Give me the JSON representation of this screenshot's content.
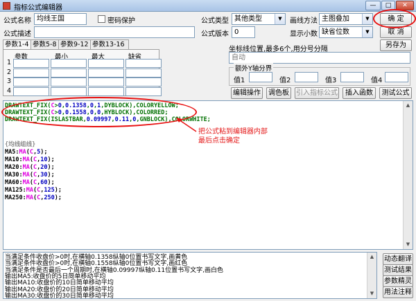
{
  "window": {
    "title": "指标公式编辑器",
    "btn_min": "—",
    "btn_max": "□",
    "btn_close": "✕"
  },
  "form": {
    "name_label": "公式名称",
    "name_value": "均线王国",
    "password_label": "密码保护",
    "desc_label": "公式描述",
    "desc_value": "",
    "type_label": "公式类型",
    "type_value": "其他类型",
    "draw_label": "画线方法",
    "draw_value": "主图叠加",
    "version_label": "公式版本",
    "version_value": "0",
    "decimal_label": "显示小数",
    "decimal_value": "缺省位数",
    "coord_label": "坐标线位置,最多6个,用分号分隔",
    "coord_value": "自动",
    "extra_y_label": "额外Y轴分界",
    "y_labels": [
      "值1",
      "值2",
      "值3",
      "值4"
    ]
  },
  "buttons": {
    "confirm": "确 定",
    "cancel": "取 消",
    "save_as": "另存为",
    "edit_op": "编辑操作",
    "palette": "调色板",
    "import_formula": "引入指标公式",
    "insert_func": "插入函数",
    "test_formula": "测试公式",
    "dynamic_translate": "动态翻译",
    "test_result": "测试结果",
    "param_wizard": "参数精灵",
    "usage_notes": "用法注释"
  },
  "tabs": [
    "参数1-4",
    "参数5-8",
    "参数9-12",
    "参数13-16"
  ],
  "params": {
    "headers": [
      "参数",
      "最小",
      "最大",
      "缺省"
    ],
    "rows": [
      "1",
      "2",
      "3",
      "4"
    ]
  },
  "code": [
    {
      "segs": [
        {
          "t": "DRAWTEXT_FIX(",
          "c": "#007000"
        },
        {
          "t": "C",
          "c": "#e000e0"
        },
        {
          "t": ">",
          "c": "#007000"
        },
        {
          "t": "0",
          "c": "#0000c0"
        },
        {
          "t": ",",
          "c": "#007000"
        },
        {
          "t": "0.1358",
          "c": "#0000c0"
        },
        {
          "t": ",",
          "c": "#007000"
        },
        {
          "t": "0",
          "c": "#0000c0"
        },
        {
          "t": ",",
          "c": "#007000"
        },
        {
          "t": "1",
          "c": "#0000c0"
        },
        {
          "t": ",DYBLOCK),COLORYELLOW;",
          "c": "#007000"
        }
      ]
    },
    {
      "segs": [
        {
          "t": "DRAWTEXT_FIX(",
          "c": "#007000"
        },
        {
          "t": "C",
          "c": "#e000e0"
        },
        {
          "t": ">",
          "c": "#007000"
        },
        {
          "t": "0",
          "c": "#0000c0"
        },
        {
          "t": ",",
          "c": "#007000"
        },
        {
          "t": "0.1558",
          "c": "#0000c0"
        },
        {
          "t": ",",
          "c": "#007000"
        },
        {
          "t": "0",
          "c": "#0000c0"
        },
        {
          "t": ",",
          "c": "#007000"
        },
        {
          "t": "0",
          "c": "#0000c0"
        },
        {
          "t": ",HYBLOCK),COLORRED;",
          "c": "#007000"
        }
      ]
    },
    {
      "segs": [
        {
          "t": "DRAWTEXT_FIX(ISLASTBAR,",
          "c": "#007000"
        },
        {
          "t": "0.09997",
          "c": "#0000c0"
        },
        {
          "t": ",",
          "c": "#007000"
        },
        {
          "t": "0.11",
          "c": "#0000c0"
        },
        {
          "t": ",",
          "c": "#007000"
        },
        {
          "t": "0",
          "c": "#0000c0"
        },
        {
          "t": ",GNBLOCK),COLORWHITE;",
          "c": "#007000"
        }
      ]
    },
    {
      "segs": [
        {
          "t": "",
          "c": "#000"
        }
      ]
    },
    {
      "segs": [
        {
          "t": "{均线组线}",
          "c": "#8a8a8a"
        }
      ]
    },
    {
      "segs": [
        {
          "t": "MA5:",
          "c": "#000"
        },
        {
          "t": "MA",
          "c": "#e000e0"
        },
        {
          "t": "(",
          "c": "#000"
        },
        {
          "t": "C",
          "c": "#e000e0"
        },
        {
          "t": ",",
          "c": "#000"
        },
        {
          "t": "5",
          "c": "#0000c0"
        },
        {
          "t": ");",
          "c": "#000"
        }
      ]
    },
    {
      "segs": [
        {
          "t": "MA10:",
          "c": "#000"
        },
        {
          "t": "MA",
          "c": "#e000e0"
        },
        {
          "t": "(",
          "c": "#000"
        },
        {
          "t": "C",
          "c": "#e000e0"
        },
        {
          "t": ",",
          "c": "#000"
        },
        {
          "t": "10",
          "c": "#0000c0"
        },
        {
          "t": ");",
          "c": "#000"
        }
      ]
    },
    {
      "segs": [
        {
          "t": "MA20:",
          "c": "#000"
        },
        {
          "t": "MA",
          "c": "#e000e0"
        },
        {
          "t": "(",
          "c": "#000"
        },
        {
          "t": "C",
          "c": "#e000e0"
        },
        {
          "t": ",",
          "c": "#000"
        },
        {
          "t": "20",
          "c": "#0000c0"
        },
        {
          "t": ");",
          "c": "#000"
        }
      ]
    },
    {
      "segs": [
        {
          "t": "MA30:",
          "c": "#000"
        },
        {
          "t": "MA",
          "c": "#e000e0"
        },
        {
          "t": "(",
          "c": "#000"
        },
        {
          "t": "C",
          "c": "#e000e0"
        },
        {
          "t": ",",
          "c": "#000"
        },
        {
          "t": "30",
          "c": "#0000c0"
        },
        {
          "t": ");",
          "c": "#000"
        }
      ]
    },
    {
      "segs": [
        {
          "t": "MA60:",
          "c": "#000"
        },
        {
          "t": "MA",
          "c": "#e000e0"
        },
        {
          "t": "(",
          "c": "#000"
        },
        {
          "t": "C",
          "c": "#e000e0"
        },
        {
          "t": ",",
          "c": "#000"
        },
        {
          "t": "60",
          "c": "#0000c0"
        },
        {
          "t": ");",
          "c": "#000"
        }
      ]
    },
    {
      "segs": [
        {
          "t": "MA125:",
          "c": "#000"
        },
        {
          "t": "MA",
          "c": "#e000e0"
        },
        {
          "t": "(",
          "c": "#000"
        },
        {
          "t": "C",
          "c": "#e000e0"
        },
        {
          "t": ",",
          "c": "#000"
        },
        {
          "t": "125",
          "c": "#0000c0"
        },
        {
          "t": ");",
          "c": "#000"
        }
      ]
    },
    {
      "segs": [
        {
          "t": "MA250:",
          "c": "#000"
        },
        {
          "t": "MA",
          "c": "#e000e0"
        },
        {
          "t": "(",
          "c": "#000"
        },
        {
          "t": "C",
          "c": "#e000e0"
        },
        {
          "t": ",",
          "c": "#000"
        },
        {
          "t": "250",
          "c": "#0000c0"
        },
        {
          "t": ");",
          "c": "#000"
        }
      ]
    }
  ],
  "annotation": {
    "line1": "把公式粘到编辑器内部",
    "line2": "最后点击确定",
    "color": "#e81010"
  },
  "output_lines": [
    "当满足条件收盘价>0时,在横轴0.1358纵轴0位置书写文字,画黄色",
    "当满足条件收盘价>0时,在横轴0.1558纵轴0位置书写文字,画红色",
    "当满足条件是否最后一个周期时,在横轴0.09997纵轴0.11位置书写文字,画白色",
    "输出MA5:收盘价的5日简单移动平均",
    "输出MA10:收盘价的10日简单移动平均",
    "输出MA20:收盘价的20日简单移动平均",
    "输出MA30:收盘价的30日简单移动平均"
  ]
}
